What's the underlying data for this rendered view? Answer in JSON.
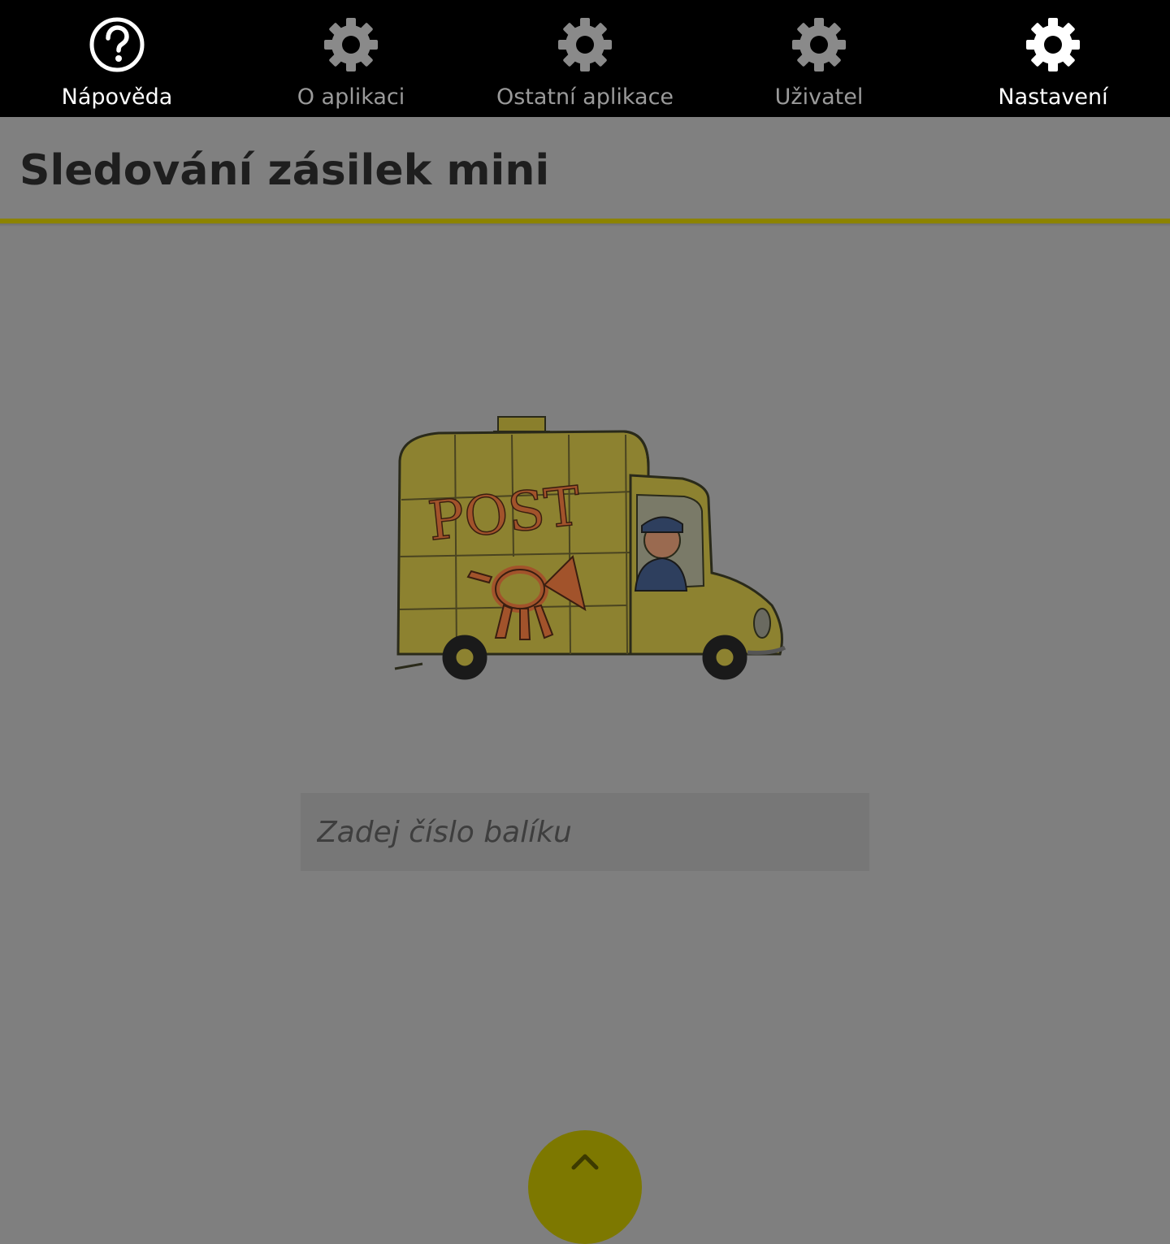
{
  "topbar": {
    "items": [
      {
        "label": "Nápověda",
        "icon": "help-circle-icon",
        "state": "active"
      },
      {
        "label": "O aplikaci",
        "icon": "gear-icon",
        "state": "inactive"
      },
      {
        "label": "Ostatní aplikace",
        "icon": "gear-icon",
        "state": "inactive"
      },
      {
        "label": "Uživatel",
        "icon": "gear-icon",
        "state": "inactive"
      },
      {
        "label": "Nastavení",
        "icon": "gear-icon",
        "state": "active"
      }
    ]
  },
  "header": {
    "title": "Sledování zásilek mini"
  },
  "illustration": {
    "name": "post-truck-illustration",
    "lettering": "POST"
  },
  "search": {
    "placeholder": "Zadej číslo balíku",
    "value": ""
  },
  "fab": {
    "icon": "chevron-up-icon"
  },
  "colors": {
    "background": "#7f7f7f",
    "topbar": "#000000",
    "accent": "#8c8300",
    "fab": "#7d7800",
    "title_text": "#1e1e1e"
  }
}
